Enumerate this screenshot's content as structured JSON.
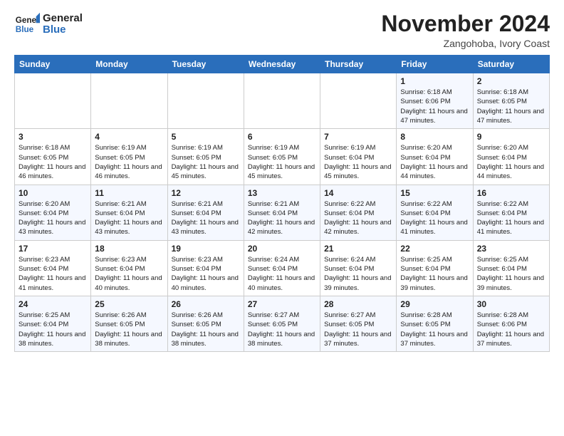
{
  "logo": {
    "line1": "General",
    "line2": "Blue"
  },
  "title": "November 2024",
  "location": "Zangohoba, Ivory Coast",
  "weekdays": [
    "Sunday",
    "Monday",
    "Tuesday",
    "Wednesday",
    "Thursday",
    "Friday",
    "Saturday"
  ],
  "weeks": [
    [
      {
        "day": "",
        "info": ""
      },
      {
        "day": "",
        "info": ""
      },
      {
        "day": "",
        "info": ""
      },
      {
        "day": "",
        "info": ""
      },
      {
        "day": "",
        "info": ""
      },
      {
        "day": "1",
        "info": "Sunrise: 6:18 AM\nSunset: 6:06 PM\nDaylight: 11 hours and 47 minutes."
      },
      {
        "day": "2",
        "info": "Sunrise: 6:18 AM\nSunset: 6:05 PM\nDaylight: 11 hours and 47 minutes."
      }
    ],
    [
      {
        "day": "3",
        "info": "Sunrise: 6:18 AM\nSunset: 6:05 PM\nDaylight: 11 hours and 46 minutes."
      },
      {
        "day": "4",
        "info": "Sunrise: 6:19 AM\nSunset: 6:05 PM\nDaylight: 11 hours and 46 minutes."
      },
      {
        "day": "5",
        "info": "Sunrise: 6:19 AM\nSunset: 6:05 PM\nDaylight: 11 hours and 45 minutes."
      },
      {
        "day": "6",
        "info": "Sunrise: 6:19 AM\nSunset: 6:05 PM\nDaylight: 11 hours and 45 minutes."
      },
      {
        "day": "7",
        "info": "Sunrise: 6:19 AM\nSunset: 6:04 PM\nDaylight: 11 hours and 45 minutes."
      },
      {
        "day": "8",
        "info": "Sunrise: 6:20 AM\nSunset: 6:04 PM\nDaylight: 11 hours and 44 minutes."
      },
      {
        "day": "9",
        "info": "Sunrise: 6:20 AM\nSunset: 6:04 PM\nDaylight: 11 hours and 44 minutes."
      }
    ],
    [
      {
        "day": "10",
        "info": "Sunrise: 6:20 AM\nSunset: 6:04 PM\nDaylight: 11 hours and 43 minutes."
      },
      {
        "day": "11",
        "info": "Sunrise: 6:21 AM\nSunset: 6:04 PM\nDaylight: 11 hours and 43 minutes."
      },
      {
        "day": "12",
        "info": "Sunrise: 6:21 AM\nSunset: 6:04 PM\nDaylight: 11 hours and 43 minutes."
      },
      {
        "day": "13",
        "info": "Sunrise: 6:21 AM\nSunset: 6:04 PM\nDaylight: 11 hours and 42 minutes."
      },
      {
        "day": "14",
        "info": "Sunrise: 6:22 AM\nSunset: 6:04 PM\nDaylight: 11 hours and 42 minutes."
      },
      {
        "day": "15",
        "info": "Sunrise: 6:22 AM\nSunset: 6:04 PM\nDaylight: 11 hours and 41 minutes."
      },
      {
        "day": "16",
        "info": "Sunrise: 6:22 AM\nSunset: 6:04 PM\nDaylight: 11 hours and 41 minutes."
      }
    ],
    [
      {
        "day": "17",
        "info": "Sunrise: 6:23 AM\nSunset: 6:04 PM\nDaylight: 11 hours and 41 minutes."
      },
      {
        "day": "18",
        "info": "Sunrise: 6:23 AM\nSunset: 6:04 PM\nDaylight: 11 hours and 40 minutes."
      },
      {
        "day": "19",
        "info": "Sunrise: 6:23 AM\nSunset: 6:04 PM\nDaylight: 11 hours and 40 minutes."
      },
      {
        "day": "20",
        "info": "Sunrise: 6:24 AM\nSunset: 6:04 PM\nDaylight: 11 hours and 40 minutes."
      },
      {
        "day": "21",
        "info": "Sunrise: 6:24 AM\nSunset: 6:04 PM\nDaylight: 11 hours and 39 minutes."
      },
      {
        "day": "22",
        "info": "Sunrise: 6:25 AM\nSunset: 6:04 PM\nDaylight: 11 hours and 39 minutes."
      },
      {
        "day": "23",
        "info": "Sunrise: 6:25 AM\nSunset: 6:04 PM\nDaylight: 11 hours and 39 minutes."
      }
    ],
    [
      {
        "day": "24",
        "info": "Sunrise: 6:25 AM\nSunset: 6:04 PM\nDaylight: 11 hours and 38 minutes."
      },
      {
        "day": "25",
        "info": "Sunrise: 6:26 AM\nSunset: 6:05 PM\nDaylight: 11 hours and 38 minutes."
      },
      {
        "day": "26",
        "info": "Sunrise: 6:26 AM\nSunset: 6:05 PM\nDaylight: 11 hours and 38 minutes."
      },
      {
        "day": "27",
        "info": "Sunrise: 6:27 AM\nSunset: 6:05 PM\nDaylight: 11 hours and 38 minutes."
      },
      {
        "day": "28",
        "info": "Sunrise: 6:27 AM\nSunset: 6:05 PM\nDaylight: 11 hours and 37 minutes."
      },
      {
        "day": "29",
        "info": "Sunrise: 6:28 AM\nSunset: 6:05 PM\nDaylight: 11 hours and 37 minutes."
      },
      {
        "day": "30",
        "info": "Sunrise: 6:28 AM\nSunset: 6:06 PM\nDaylight: 11 hours and 37 minutes."
      }
    ]
  ]
}
